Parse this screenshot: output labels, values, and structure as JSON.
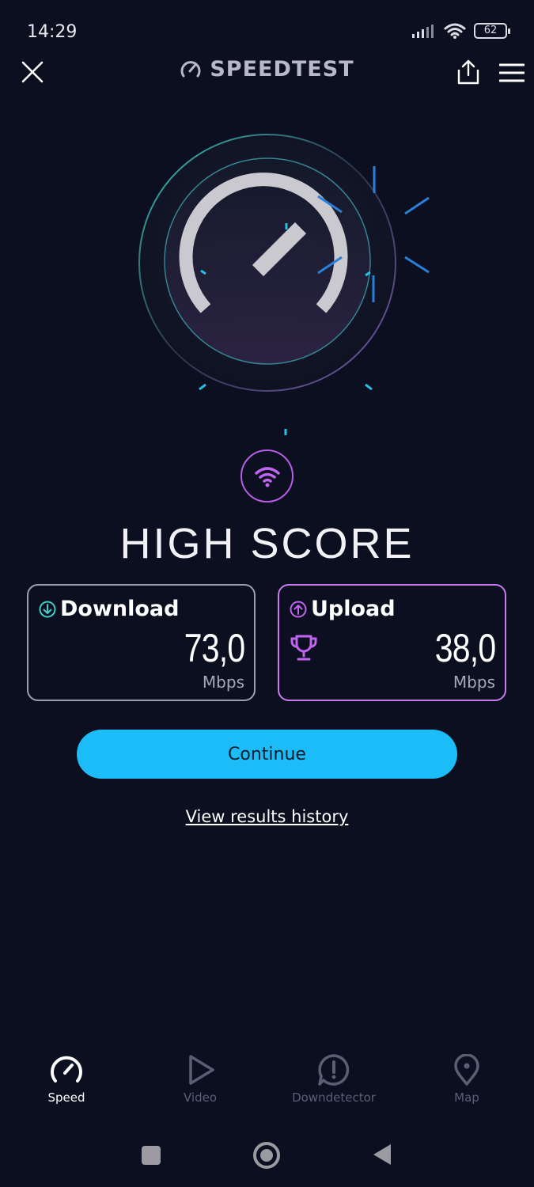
{
  "status_bar": {
    "time": "14:29",
    "battery": "62"
  },
  "header": {
    "title": "SPEEDTEST"
  },
  "score": {
    "title": "HIGH SCORE"
  },
  "download": {
    "label": "Download",
    "value": "73,0",
    "unit": "Mbps"
  },
  "upload": {
    "label": "Upload",
    "value": "38,0",
    "unit": "Mbps"
  },
  "actions": {
    "continue_label": "Continue",
    "history_label": "View results history"
  },
  "bottom_nav": {
    "items": [
      {
        "label": "Speed",
        "icon": "speedometer-icon",
        "active": true
      },
      {
        "label": "Video",
        "icon": "play-icon",
        "active": false
      },
      {
        "label": "Downdetector",
        "icon": "alert-icon",
        "active": false
      },
      {
        "label": "Map",
        "icon": "map-pin-icon",
        "active": false
      }
    ]
  },
  "colors": {
    "background": "#0c0f1f",
    "accent_cyan": "#1bbcf7",
    "accent_purple": "#c77df0"
  }
}
